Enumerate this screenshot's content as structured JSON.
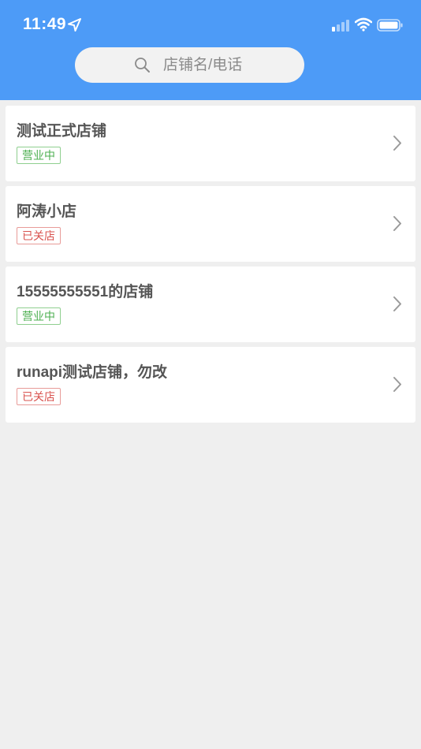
{
  "status_bar": {
    "time": "11:49",
    "icons": [
      "location-arrow-icon",
      "cellular-signal-icon",
      "wifi-icon",
      "battery-icon"
    ]
  },
  "header": {
    "color": "#4d9bf7"
  },
  "search": {
    "placeholder": "店铺名/电话",
    "value": ""
  },
  "stores": [
    {
      "name": "测试正式店铺",
      "status": "营业中",
      "status_type": "open"
    },
    {
      "name": "阿涛小店",
      "status": "已关店",
      "status_type": "closed"
    },
    {
      "name": "15555555551的店铺",
      "status": "营业中",
      "status_type": "open"
    },
    {
      "name": "runapi测试店铺，勿改",
      "status": "已关店",
      "status_type": "closed"
    }
  ],
  "colors": {
    "accent": "#4d9bf7",
    "open": "#4caf50",
    "closed": "#d9534f",
    "background": "#efefef"
  }
}
